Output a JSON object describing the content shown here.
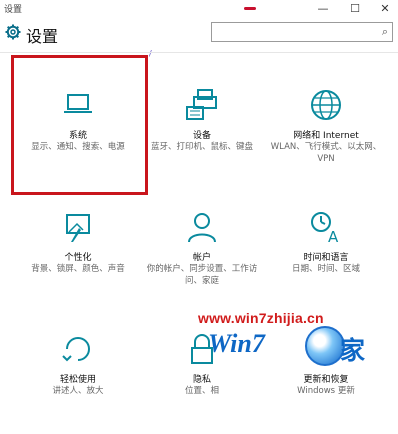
{
  "window": {
    "title": "设置",
    "minimize": "—",
    "maximize": "☐",
    "close": "✕"
  },
  "header": {
    "page_title": "设置",
    "search_placeholder": "",
    "stray_text": "/"
  },
  "tiles": [
    {
      "label": "系统",
      "desc": "显示、通知、搜索、电源",
      "icon": "laptop-icon"
    },
    {
      "label": "设备",
      "desc": "蓝牙、打印机、鼠标、键盘",
      "icon": "printer-keyboard-icon"
    },
    {
      "label": "网络和 Internet",
      "desc": "WLAN、飞行模式、以太网、VPN",
      "icon": "globe-icon"
    },
    {
      "label": "个性化",
      "desc": "背景、锁屏、颜色、声音",
      "icon": "paint-brush-icon"
    },
    {
      "label": "帐户",
      "desc": "你的帐户、同步设置、工作访问、家庭",
      "icon": "person-icon"
    },
    {
      "label": "时间和语言",
      "desc": "日期、时间、区域",
      "icon": "time-language-icon"
    },
    {
      "label": "轻松使用",
      "desc": "讲述人、放大",
      "icon": "accessibility-icon"
    },
    {
      "label": "隐私",
      "desc": "位置、相",
      "icon": "lock-icon"
    },
    {
      "label": "更新和恢复",
      "desc": "Windows 更新",
      "icon": "refresh-icon"
    }
  ],
  "watermark": {
    "url": "www.win7zhijia.cn",
    "logo_text": "Win7",
    "logo_char": "家"
  },
  "colors": {
    "accent": "#0a8a9e",
    "highlight_border": "#c9151c"
  }
}
